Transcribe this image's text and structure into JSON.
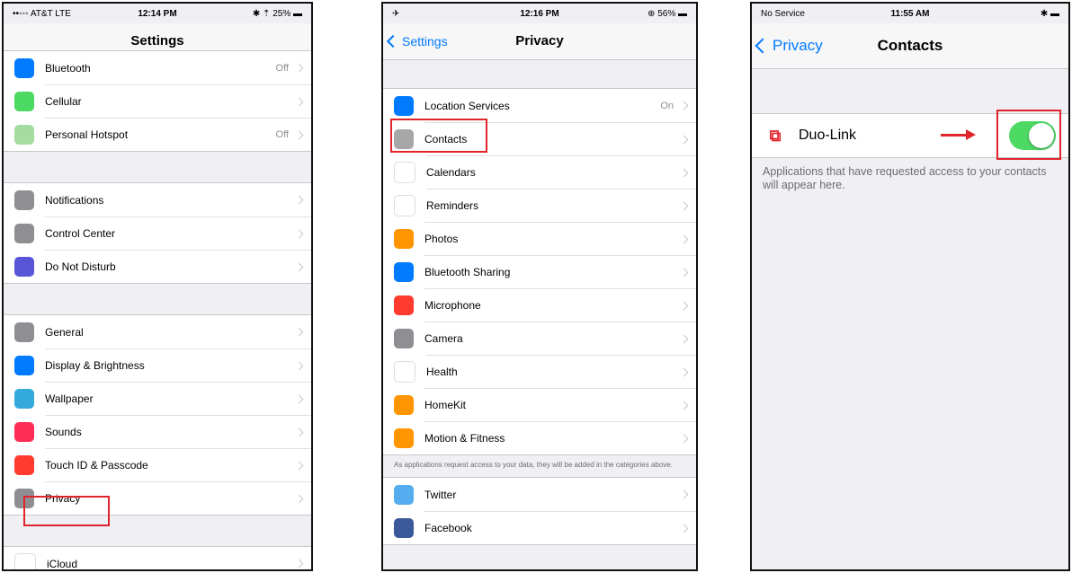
{
  "colors": {
    "accent": "#007aff",
    "toggle_on": "#4cd964",
    "highlight": "#e0242b"
  },
  "screen1": {
    "status": {
      "carrier": "••◦◦◦ AT&T LTE",
      "time": "12:14 PM",
      "right": "✱ ⇡ 25% ▬"
    },
    "title": "Settings",
    "groups": [
      {
        "items": [
          {
            "label": "Bluetooth",
            "value": "Off",
            "icon": "bluetooth-icon",
            "color": "#007aff"
          },
          {
            "label": "Cellular",
            "value": "",
            "icon": "cellular-icon",
            "color": "#4cd964"
          },
          {
            "label": "Personal Hotspot",
            "value": "Off",
            "icon": "hotspot-icon",
            "color": "#a5dca0"
          }
        ]
      },
      {
        "items": [
          {
            "label": "Notifications",
            "value": "",
            "icon": "notifications-icon",
            "color": "#8e8e93"
          },
          {
            "label": "Control Center",
            "value": "",
            "icon": "control-center-icon",
            "color": "#8e8e93"
          },
          {
            "label": "Do Not Disturb",
            "value": "",
            "icon": "moon-icon",
            "color": "#5856d6"
          }
        ]
      },
      {
        "items": [
          {
            "label": "General",
            "value": "",
            "icon": "gear-icon",
            "color": "#8e8e93"
          },
          {
            "label": "Display & Brightness",
            "value": "",
            "icon": "display-icon",
            "color": "#007aff"
          },
          {
            "label": "Wallpaper",
            "value": "",
            "icon": "wallpaper-icon",
            "color": "#34aadc"
          },
          {
            "label": "Sounds",
            "value": "",
            "icon": "sounds-icon",
            "color": "#ff2d55"
          },
          {
            "label": "Touch ID & Passcode",
            "value": "",
            "icon": "fingerprint-icon",
            "color": "#ff3b30"
          },
          {
            "label": "Privacy",
            "value": "",
            "icon": "hand-icon",
            "color": "#8e8e93"
          }
        ]
      },
      {
        "items": [
          {
            "label": "iCloud",
            "value": "",
            "icon": "icloud-icon",
            "color": "#ffffff"
          }
        ]
      }
    ]
  },
  "screen2": {
    "status": {
      "carrier": "✈",
      "time": "12:16 PM",
      "right": "⊕ 56% ▬"
    },
    "back": "Settings",
    "title": "Privacy",
    "items": [
      {
        "label": "Location Services",
        "value": "On",
        "icon": "location-icon",
        "color": "#007aff"
      },
      {
        "label": "Contacts",
        "value": "",
        "icon": "contacts-icon",
        "color": "#a7a7a7"
      },
      {
        "label": "Calendars",
        "value": "",
        "icon": "calendar-icon",
        "color": "#ffffff"
      },
      {
        "label": "Reminders",
        "value": "",
        "icon": "reminders-icon",
        "color": "#ffffff"
      },
      {
        "label": "Photos",
        "value": "",
        "icon": "photos-icon",
        "color": "#ff9500"
      },
      {
        "label": "Bluetooth Sharing",
        "value": "",
        "icon": "bluetooth-icon",
        "color": "#007aff"
      },
      {
        "label": "Microphone",
        "value": "",
        "icon": "microphone-icon",
        "color": "#ff3b30"
      },
      {
        "label": "Camera",
        "value": "",
        "icon": "camera-icon",
        "color": "#8e8e93"
      },
      {
        "label": "Health",
        "value": "",
        "icon": "heart-icon",
        "color": "#ffffff"
      },
      {
        "label": "HomeKit",
        "value": "",
        "icon": "homekit-icon",
        "color": "#ff9500"
      },
      {
        "label": "Motion & Fitness",
        "value": "",
        "icon": "motion-icon",
        "color": "#ff9500"
      }
    ],
    "note": "As applications request access to your data, they will be added in the categories above.",
    "social": [
      {
        "label": "Twitter",
        "value": "",
        "icon": "twitter-icon",
        "color": "#55acee"
      },
      {
        "label": "Facebook",
        "value": "",
        "icon": "facebook-icon",
        "color": "#3b5998"
      }
    ]
  },
  "screen3": {
    "status": {
      "carrier": "No Service",
      "time": "11:55 AM",
      "right": "✱ ▬"
    },
    "back": "Privacy",
    "title": "Contacts",
    "app": {
      "label": "Duo-Link",
      "icon": "duo-link-icon",
      "toggle_on": true
    },
    "note": "Applications that have requested access to your contacts will appear here."
  }
}
